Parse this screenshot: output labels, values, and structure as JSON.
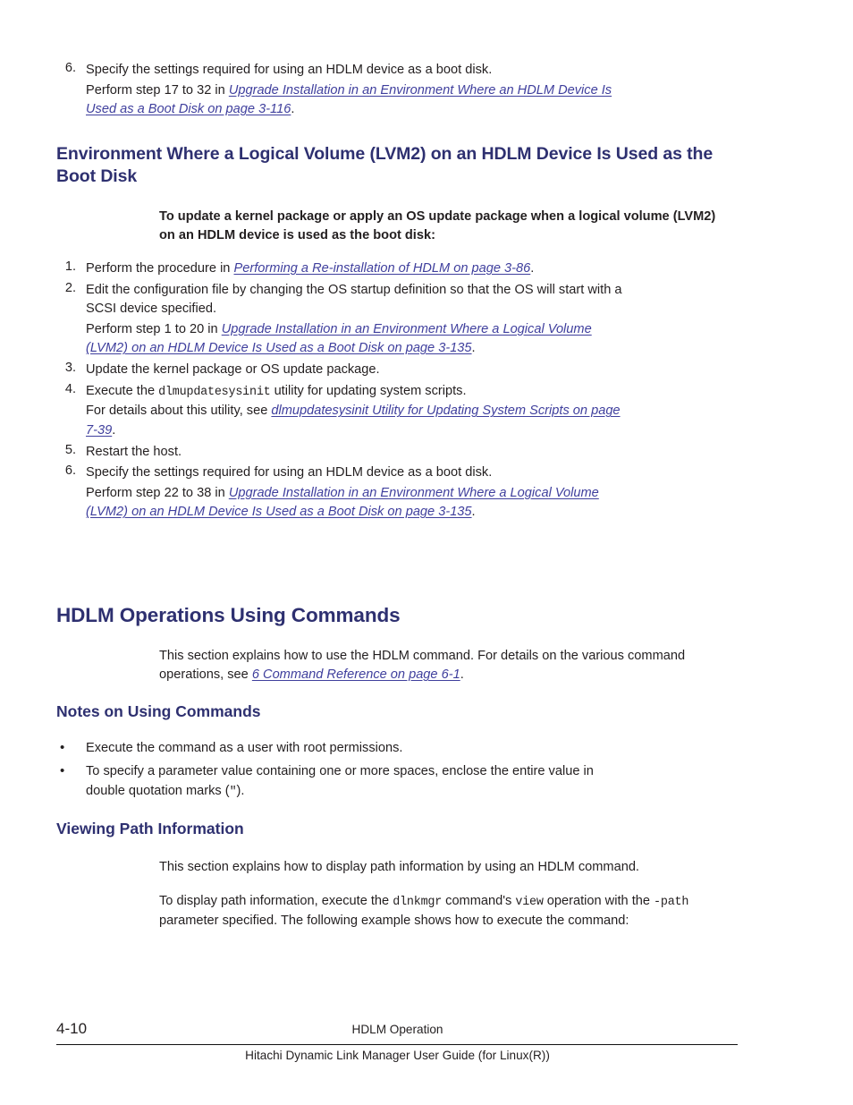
{
  "page": {
    "folio": "4-10",
    "running_head": "HDLM Operation",
    "guide_title": "Hitachi Dynamic Link Manager User Guide (for Linux(R))"
  },
  "top_step": {
    "number": "6.",
    "text": "Specify the settings required for using an HDLM device as a boot disk.",
    "followup_prefix": "Perform step 17 to 32 in ",
    "followup_link": "Upgrade Installation in an Environment Where an HDLM Device Is Used as a Boot Disk on page 3-116",
    "followup_suffix": "."
  },
  "section_lvm2": {
    "heading": "Environment Where a Logical Volume (LVM2) on an HDLM Device Is Used as the Boot Disk",
    "lead": "To update a kernel package or apply an OS update package when a logical volume (LVM2) on an HDLM device is used as the boot disk:",
    "steps": [
      {
        "number": "1.",
        "prefix": "Perform the procedure in ",
        "link": "Performing a Re-installation of HDLM on page 3-86",
        "suffix": "."
      },
      {
        "number": "2.",
        "text": "Edit the configuration file by changing the OS startup definition so that the OS will start with a SCSI device specified.",
        "followup_prefix": "Perform step 1 to 20 in ",
        "followup_link": "Upgrade Installation in an Environment Where a Logical Volume (LVM2) on an HDLM Device Is Used as a Boot Disk on page 3-135",
        "followup_suffix": "."
      },
      {
        "number": "3.",
        "text": "Update the kernel package or OS update package."
      },
      {
        "number": "4.",
        "prefix": "Execute the ",
        "code": "dlmupdatesysinit",
        "suffix": " utility for updating system scripts.",
        "followup_prefix": "For details about this utility, see ",
        "followup_link": "dlmupdatesysinit Utility for Updating System Scripts on page 7-39",
        "followup_suffix": "."
      },
      {
        "number": "5.",
        "text": "Restart the host."
      },
      {
        "number": "6.",
        "text": "Specify the settings required for using an HDLM device as a boot disk.",
        "followup_prefix": "Perform step 22 to 38 in ",
        "followup_link": "Upgrade Installation in an Environment Where a Logical Volume (LVM2) on an HDLM Device Is Used as a Boot Disk on page 3-135",
        "followup_suffix": "."
      }
    ]
  },
  "section_operations": {
    "heading": "HDLM Operations Using Commands",
    "intro_prefix": "This section explains how to use the HDLM command. For details on the various command operations, see ",
    "intro_link": "6 Command Reference on page 6-1",
    "intro_suffix": "."
  },
  "section_notes": {
    "heading": "Notes on Using Commands",
    "bullets": [
      {
        "text": "Execute the command as a user with root permissions."
      },
      {
        "prefix": "To specify a parameter value containing one or more spaces, enclose the entire value in double quotation marks (",
        "code": "\"",
        "suffix": ")."
      }
    ],
    "bullet_marker": "•"
  },
  "section_viewing": {
    "heading": "Viewing Path Information",
    "para1": "This section explains how to display path information by using an HDLM command.",
    "para2_part1": "To display path information, execute the ",
    "para2_code1": "dlnkmgr",
    "para2_part2": " command's ",
    "para2_code2": "view",
    "para2_part3": " operation with the ",
    "para2_code3": "-path",
    "para2_part4": " parameter specified. The following example shows how to execute the command:"
  },
  "colors": {
    "heading": "#2e3070",
    "link": "#3f3f9d",
    "body": "#231f20"
  }
}
